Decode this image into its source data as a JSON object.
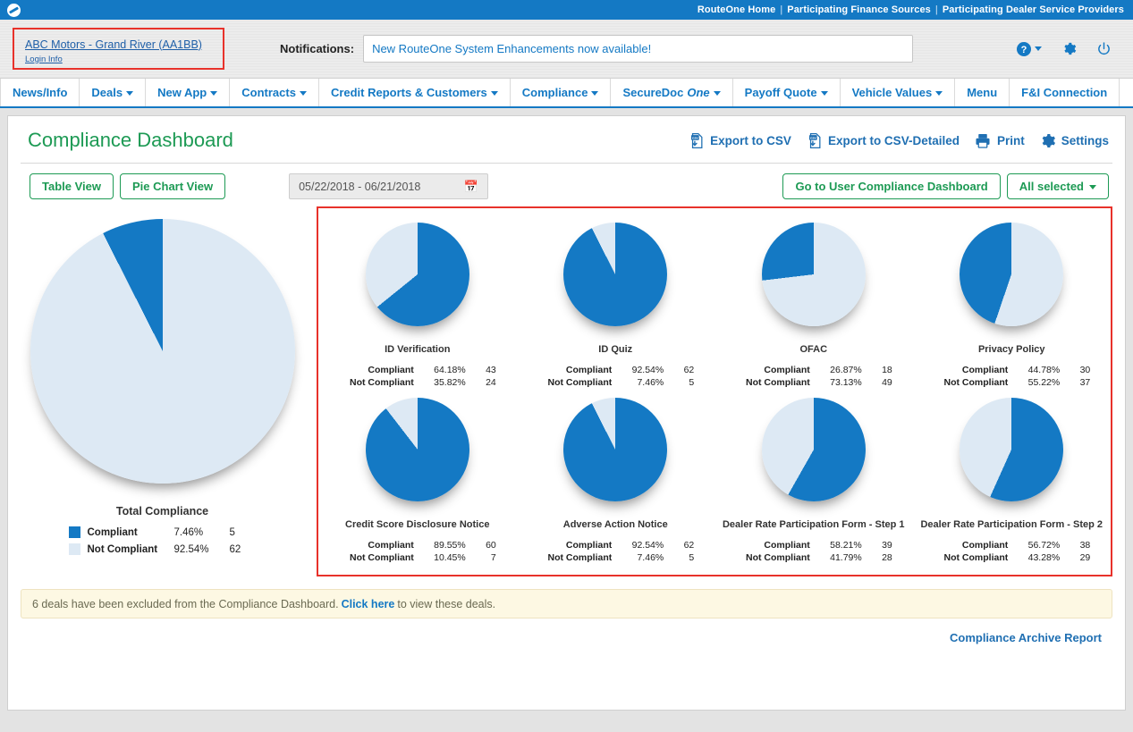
{
  "topbar": {
    "logo_name": "routeone-logo",
    "links": [
      {
        "label": "RouteOne Home"
      },
      {
        "label": "Participating Finance Sources"
      },
      {
        "label": "Participating Dealer Service Providers"
      }
    ],
    "separator": "|"
  },
  "identity": {
    "dealer_name": "ABC Motors - Grand River (AA1BB)",
    "login_info": "Login Info",
    "notifications_label": "Notifications:",
    "notification_text": "New RouteOne System Enhancements now available!",
    "help_icon": "help-icon",
    "settings_icon": "gear-icon",
    "power_icon": "power-icon"
  },
  "nav": {
    "items": [
      {
        "label": "News/Info",
        "caret": false
      },
      {
        "label": "Deals",
        "caret": true
      },
      {
        "label": "New App",
        "caret": true
      },
      {
        "label": "Contracts",
        "caret": true
      },
      {
        "label": "Credit Reports & Customers",
        "caret": true
      },
      {
        "label": "Compliance",
        "caret": true
      },
      {
        "label": "SecureDoc",
        "label_italic": "One",
        "caret": true
      },
      {
        "label": "Payoff Quote",
        "caret": true
      },
      {
        "label": "Vehicle Values",
        "caret": true
      },
      {
        "label": "Menu",
        "caret": false
      },
      {
        "label": "F&I Connection",
        "caret": false
      }
    ]
  },
  "page": {
    "title": "Compliance Dashboard",
    "actions": [
      {
        "label": "Export to CSV",
        "icon": "csv-export-icon"
      },
      {
        "label": "Export to CSV-Detailed",
        "icon": "csv-export-icon"
      },
      {
        "label": "Print",
        "icon": "printer-icon"
      },
      {
        "label": "Settings",
        "icon": "gear-icon"
      }
    ]
  },
  "toolbar": {
    "table_view": "Table View",
    "pie_chart_view": "Pie Chart View",
    "date_range": "05/22/2018 - 06/21/2018",
    "calendar_icon": "calendar-icon",
    "user_dashboard": "Go to User Compliance Dashboard",
    "all_selected": "All selected"
  },
  "legend_labels": {
    "compliant": "Compliant",
    "not_compliant": "Not Compliant"
  },
  "colors": {
    "compliant": "#1479c4",
    "not_compliant": "#dde9f4",
    "brand_blue": "#1479c4",
    "green": "#1d9a54",
    "link_blue": "#1f6fb2",
    "highlight_red": "#e8322b"
  },
  "footer": {
    "excluded_prefix": "6 deals have been excluded from the Compliance Dashboard.",
    "excluded_link": "Click here",
    "excluded_suffix": "to view these deals.",
    "archive_report": "Compliance Archive Report"
  },
  "chart_data": [
    {
      "type": "pie",
      "title": "Total Compliance",
      "size": "large",
      "categories": [
        "Compliant",
        "Not Compliant"
      ],
      "values": [
        7.46,
        92.54
      ],
      "counts": [
        5,
        62
      ],
      "percent_labels": [
        "7.46%",
        "92.54%"
      ],
      "colors": [
        "#1479c4",
        "#dde9f4"
      ],
      "direction": "counterclockwise",
      "legend": "below"
    },
    {
      "type": "pie",
      "title": "ID Verification",
      "size": "small",
      "categories": [
        "Compliant",
        "Not Compliant"
      ],
      "values": [
        64.18,
        35.82
      ],
      "counts": [
        43,
        24
      ],
      "percent_labels": [
        "64.18%",
        "35.82%"
      ],
      "colors": [
        "#1479c4",
        "#dde9f4"
      ],
      "direction": "clockwise",
      "legend": "below"
    },
    {
      "type": "pie",
      "title": "ID Quiz",
      "size": "small",
      "categories": [
        "Compliant",
        "Not Compliant"
      ],
      "values": [
        92.54,
        7.46
      ],
      "counts": [
        62,
        5
      ],
      "percent_labels": [
        "92.54%",
        "7.46%"
      ],
      "colors": [
        "#1479c4",
        "#dde9f4"
      ],
      "direction": "clockwise",
      "legend": "below"
    },
    {
      "type": "pie",
      "title": "OFAC",
      "size": "small",
      "categories": [
        "Compliant",
        "Not Compliant"
      ],
      "values": [
        26.87,
        73.13
      ],
      "counts": [
        18,
        49
      ],
      "percent_labels": [
        "26.87%",
        "73.13%"
      ],
      "colors": [
        "#1479c4",
        "#dde9f4"
      ],
      "direction": "counterclockwise",
      "legend": "below"
    },
    {
      "type": "pie",
      "title": "Privacy Policy",
      "size": "small",
      "categories": [
        "Compliant",
        "Not Compliant"
      ],
      "values": [
        44.78,
        55.22
      ],
      "counts": [
        30,
        37
      ],
      "percent_labels": [
        "44.78%",
        "55.22%"
      ],
      "colors": [
        "#1479c4",
        "#dde9f4"
      ],
      "direction": "counterclockwise",
      "legend": "below"
    },
    {
      "type": "pie",
      "title": "Credit Score Disclosure Notice",
      "size": "small",
      "categories": [
        "Compliant",
        "Not Compliant"
      ],
      "values": [
        89.55,
        10.45
      ],
      "counts": [
        60,
        7
      ],
      "percent_labels": [
        "89.55%",
        "10.45%"
      ],
      "colors": [
        "#1479c4",
        "#dde9f4"
      ],
      "direction": "clockwise",
      "legend": "below"
    },
    {
      "type": "pie",
      "title": "Adverse Action Notice",
      "size": "small",
      "categories": [
        "Compliant",
        "Not Compliant"
      ],
      "values": [
        92.54,
        7.46
      ],
      "counts": [
        62,
        5
      ],
      "percent_labels": [
        "92.54%",
        "7.46%"
      ],
      "colors": [
        "#1479c4",
        "#dde9f4"
      ],
      "direction": "clockwise",
      "legend": "below"
    },
    {
      "type": "pie",
      "title": "Dealer Rate Participation Form - Step 1",
      "size": "small",
      "categories": [
        "Compliant",
        "Not Compliant"
      ],
      "values": [
        58.21,
        41.79
      ],
      "counts": [
        39,
        28
      ],
      "percent_labels": [
        "58.21%",
        "41.79%"
      ],
      "colors": [
        "#1479c4",
        "#dde9f4"
      ],
      "direction": "clockwise",
      "legend": "below"
    },
    {
      "type": "pie",
      "title": "Dealer Rate Participation Form - Step 2",
      "size": "small",
      "categories": [
        "Compliant",
        "Not Compliant"
      ],
      "values": [
        56.72,
        43.28
      ],
      "counts": [
        38,
        29
      ],
      "percent_labels": [
        "56.72%",
        "43.28%"
      ],
      "colors": [
        "#1479c4",
        "#dde9f4"
      ],
      "direction": "clockwise",
      "legend": "below"
    }
  ]
}
